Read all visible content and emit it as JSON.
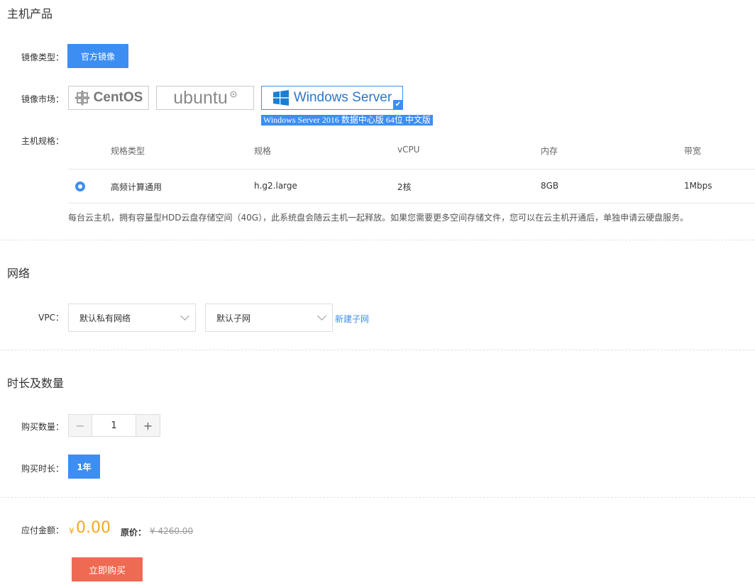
{
  "host_section": {
    "title": "主机产品",
    "image_type_label": "镜像类型：",
    "image_type_button": "官方镜像",
    "market_label": "镜像市场：",
    "market_options": [
      {
        "name": "CentOS",
        "icon": "centos-logo-icon"
      },
      {
        "name": "ubuntu",
        "icon": "ubuntu-logo-icon"
      },
      {
        "name": "Windows Server",
        "icon": "windows-logo-icon",
        "selected": true
      }
    ],
    "selected_image_text": "Windows Server 2016 数据中心版 64位 中文版",
    "spec_label": "主机规格：",
    "spec_table": {
      "headers": [
        "规格类型",
        "规格",
        "vCPU",
        "内存",
        "带宽"
      ],
      "rows": [
        {
          "type": "高频计算通用",
          "spec": "h.g2.large",
          "vcpu": "2核",
          "memory": "8GB",
          "bandwidth": "1Mbps",
          "selected": true
        }
      ]
    },
    "storage_note": "每台云主机，拥有容量型HDD云盘存储空间（40G），此系统盘会随云主机一起释放。如果您需要更多空间存储文件，您可以在云主机开通后，单独申请云硬盘服务。"
  },
  "network_section": {
    "title": "网络",
    "vpc_label": "VPC：",
    "vpc_select": "默认私有网络",
    "subnet_select": "默认子网",
    "new_subnet_link": "新建子网"
  },
  "duration_section": {
    "title": "时长及数量",
    "quantity_label": "购买数量：",
    "quantity_minus": "−",
    "quantity_value": "1",
    "quantity_plus": "+",
    "duration_label": "购买时长：",
    "duration_option": "1年"
  },
  "payment": {
    "amount_label": "应付金额：",
    "currency_symbol": "¥",
    "amount": "0.00",
    "original_label": "原价：",
    "original_price": "¥ 4260.00",
    "buy_button": "立即购买"
  },
  "colors": {
    "accent": "#3d8ef2",
    "price": "#f5a623",
    "buy": "#ef6a53"
  }
}
